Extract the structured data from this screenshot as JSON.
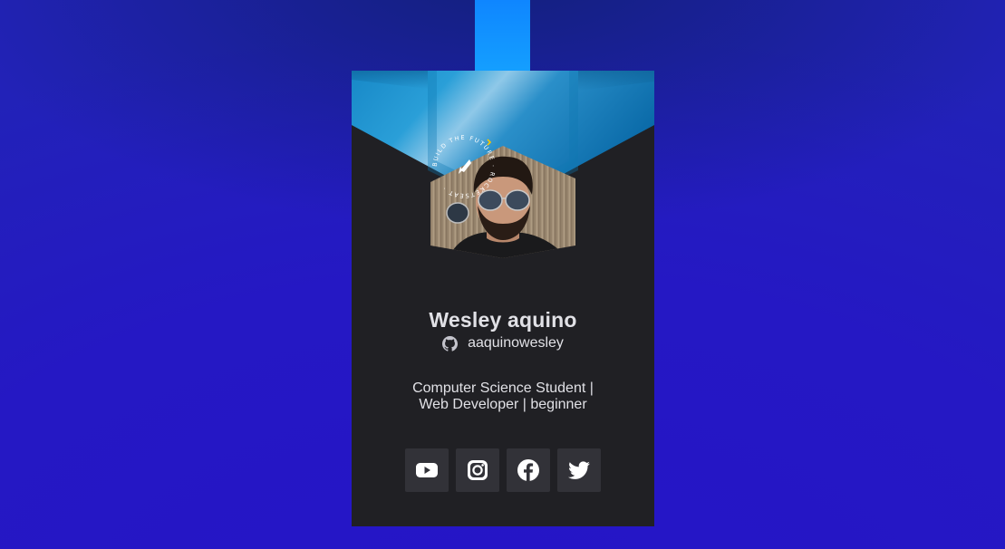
{
  "profile": {
    "name": "Wesley aquino",
    "github_username": "aaquinowesley",
    "bio": "Computer Science Student | Web Developer | beginner"
  },
  "badge": {
    "ring_text": "BUILD THE FUTURE · ROCKETSEAT ·"
  },
  "socials": [
    {
      "icon": "youtube-icon"
    },
    {
      "icon": "instagram-icon"
    },
    {
      "icon": "facebook-icon"
    },
    {
      "icon": "twitter-icon"
    }
  ],
  "colors": {
    "background": "#2420b8",
    "card": "#202024",
    "social_button": "#323238",
    "text": "#e1e1e6",
    "strap": "#0f86ff",
    "accent_yellow": "#f7c600"
  }
}
